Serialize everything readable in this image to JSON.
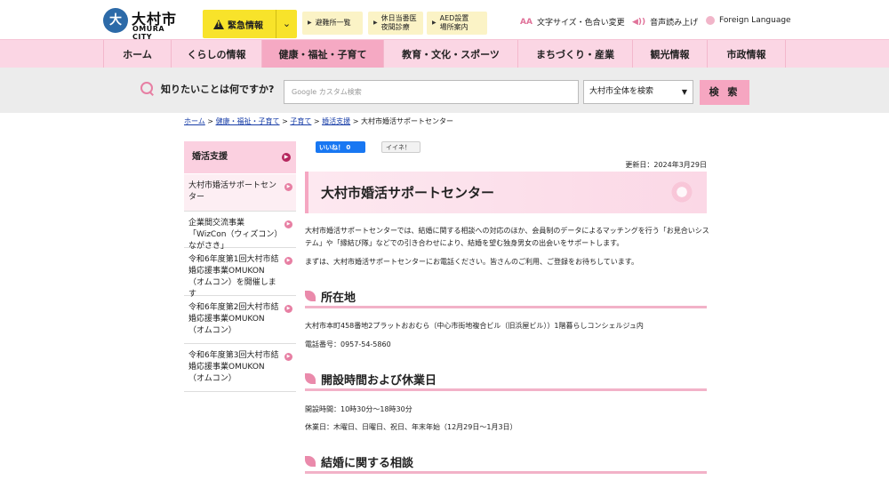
{
  "header": {
    "logo_mark": "大",
    "logo_jp": "大村市",
    "logo_en": "OMURA CITY",
    "emergency_label": "緊急情報",
    "emergency_toggle": "⌄",
    "quick_links": [
      {
        "line1": "避難所一覧",
        "line2": ""
      },
      {
        "line1": "休日当番医",
        "line2": "夜間診療"
      },
      {
        "line1": "AED設置",
        "line2": "場所案内"
      }
    ],
    "tools": {
      "font_size": "文字サイズ・色合い変更",
      "voice": "音声読み上げ",
      "language": "Foreign Language",
      "font_icon": "AA",
      "voice_icon": "◀))"
    }
  },
  "nav": [
    "ホーム",
    "くらしの情報",
    "健康・福祉・子育て",
    "教育・文化・スポーツ",
    "まちづくり・産業",
    "観光情報",
    "市政情報"
  ],
  "search": {
    "label": "知りたいことは何ですか?",
    "placeholder": "Google カスタム検索",
    "scope": "大村市全体を検索",
    "button": "検 索"
  },
  "breadcrumb": {
    "items": [
      "ホーム",
      "健康・福祉・子育て",
      "子育て",
      "婚活支援"
    ],
    "current": "大村市婚活サポートセンター",
    "sep": " > "
  },
  "sidebar": {
    "heading": "婚活支援",
    "items": [
      "大村市婚活サポートセンター",
      "企業間交流事業「WizCon（ウィズコン）ながさき」",
      "令和6年度第1回大村市結婚応援事業OMUKON（オムコン）を開催します",
      "令和6年度第2回大村市結婚応援事業OMUKON（オムコン）",
      "令和6年度第3回大村市結婚応援事業OMUKON（オムコン）"
    ]
  },
  "social": {
    "like": "いいね！ 0",
    "mixi": "イイネ！"
  },
  "main": {
    "updated": "更新日：2024年3月29日",
    "title": "大村市婚活サポートセンター",
    "intro1": "大村市婚活サポートセンターでは、結婚に関する相談への対応のほか、会員制のデータによるマッチングを行う「お見合いシステム」や「縁結び隊」などでの引き合わせにより、結婚を望む独身男女の出会いをサポートします。",
    "intro2": "まずは、大村市婚活サポートセンターにお電話ください。皆さんのご利用、ご登録をお待ちしています。",
    "sections": [
      {
        "title": "所在地",
        "lines": [
          "大村市本町458番地2プラットおおむら（中心市街地複合ビル（旧浜屋ビル））1階暮らしコンシェルジュ内",
          "電話番号：0957-54-5860"
        ]
      },
      {
        "title": "開設時間および休業日",
        "lines": [
          "開設時間：10時30分～18時30分",
          "休業日：木曜日、日曜日、祝日、年末年始（12月29日～1月3日）"
        ]
      },
      {
        "title": "結婚に関する相談",
        "lines": []
      }
    ]
  }
}
